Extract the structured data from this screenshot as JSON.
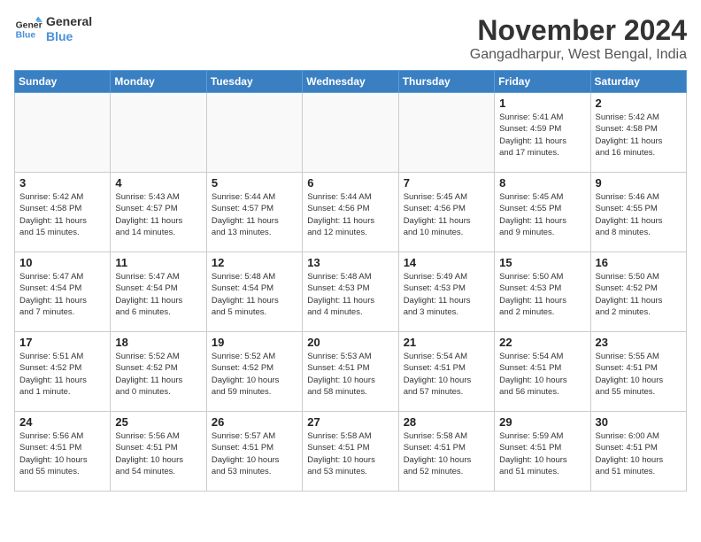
{
  "logo": {
    "line1": "General",
    "line2": "Blue"
  },
  "title": "November 2024",
  "location": "Gangadharpur, West Bengal, India",
  "headers": [
    "Sunday",
    "Monday",
    "Tuesday",
    "Wednesday",
    "Thursday",
    "Friday",
    "Saturday"
  ],
  "weeks": [
    [
      {
        "day": "",
        "info": "",
        "empty": true
      },
      {
        "day": "",
        "info": "",
        "empty": true
      },
      {
        "day": "",
        "info": "",
        "empty": true
      },
      {
        "day": "",
        "info": "",
        "empty": true
      },
      {
        "day": "",
        "info": "",
        "empty": true
      },
      {
        "day": "1",
        "info": "Sunrise: 5:41 AM\nSunset: 4:59 PM\nDaylight: 11 hours\nand 17 minutes."
      },
      {
        "day": "2",
        "info": "Sunrise: 5:42 AM\nSunset: 4:58 PM\nDaylight: 11 hours\nand 16 minutes."
      }
    ],
    [
      {
        "day": "3",
        "info": "Sunrise: 5:42 AM\nSunset: 4:58 PM\nDaylight: 11 hours\nand 15 minutes."
      },
      {
        "day": "4",
        "info": "Sunrise: 5:43 AM\nSunset: 4:57 PM\nDaylight: 11 hours\nand 14 minutes."
      },
      {
        "day": "5",
        "info": "Sunrise: 5:44 AM\nSunset: 4:57 PM\nDaylight: 11 hours\nand 13 minutes."
      },
      {
        "day": "6",
        "info": "Sunrise: 5:44 AM\nSunset: 4:56 PM\nDaylight: 11 hours\nand 12 minutes."
      },
      {
        "day": "7",
        "info": "Sunrise: 5:45 AM\nSunset: 4:56 PM\nDaylight: 11 hours\nand 10 minutes."
      },
      {
        "day": "8",
        "info": "Sunrise: 5:45 AM\nSunset: 4:55 PM\nDaylight: 11 hours\nand 9 minutes."
      },
      {
        "day": "9",
        "info": "Sunrise: 5:46 AM\nSunset: 4:55 PM\nDaylight: 11 hours\nand 8 minutes."
      }
    ],
    [
      {
        "day": "10",
        "info": "Sunrise: 5:47 AM\nSunset: 4:54 PM\nDaylight: 11 hours\nand 7 minutes."
      },
      {
        "day": "11",
        "info": "Sunrise: 5:47 AM\nSunset: 4:54 PM\nDaylight: 11 hours\nand 6 minutes."
      },
      {
        "day": "12",
        "info": "Sunrise: 5:48 AM\nSunset: 4:54 PM\nDaylight: 11 hours\nand 5 minutes."
      },
      {
        "day": "13",
        "info": "Sunrise: 5:48 AM\nSunset: 4:53 PM\nDaylight: 11 hours\nand 4 minutes."
      },
      {
        "day": "14",
        "info": "Sunrise: 5:49 AM\nSunset: 4:53 PM\nDaylight: 11 hours\nand 3 minutes."
      },
      {
        "day": "15",
        "info": "Sunrise: 5:50 AM\nSunset: 4:53 PM\nDaylight: 11 hours\nand 2 minutes."
      },
      {
        "day": "16",
        "info": "Sunrise: 5:50 AM\nSunset: 4:52 PM\nDaylight: 11 hours\nand 2 minutes."
      }
    ],
    [
      {
        "day": "17",
        "info": "Sunrise: 5:51 AM\nSunset: 4:52 PM\nDaylight: 11 hours\nand 1 minute."
      },
      {
        "day": "18",
        "info": "Sunrise: 5:52 AM\nSunset: 4:52 PM\nDaylight: 11 hours\nand 0 minutes."
      },
      {
        "day": "19",
        "info": "Sunrise: 5:52 AM\nSunset: 4:52 PM\nDaylight: 10 hours\nand 59 minutes."
      },
      {
        "day": "20",
        "info": "Sunrise: 5:53 AM\nSunset: 4:51 PM\nDaylight: 10 hours\nand 58 minutes."
      },
      {
        "day": "21",
        "info": "Sunrise: 5:54 AM\nSunset: 4:51 PM\nDaylight: 10 hours\nand 57 minutes."
      },
      {
        "day": "22",
        "info": "Sunrise: 5:54 AM\nSunset: 4:51 PM\nDaylight: 10 hours\nand 56 minutes."
      },
      {
        "day": "23",
        "info": "Sunrise: 5:55 AM\nSunset: 4:51 PM\nDaylight: 10 hours\nand 55 minutes."
      }
    ],
    [
      {
        "day": "24",
        "info": "Sunrise: 5:56 AM\nSunset: 4:51 PM\nDaylight: 10 hours\nand 55 minutes."
      },
      {
        "day": "25",
        "info": "Sunrise: 5:56 AM\nSunset: 4:51 PM\nDaylight: 10 hours\nand 54 minutes."
      },
      {
        "day": "26",
        "info": "Sunrise: 5:57 AM\nSunset: 4:51 PM\nDaylight: 10 hours\nand 53 minutes."
      },
      {
        "day": "27",
        "info": "Sunrise: 5:58 AM\nSunset: 4:51 PM\nDaylight: 10 hours\nand 53 minutes."
      },
      {
        "day": "28",
        "info": "Sunrise: 5:58 AM\nSunset: 4:51 PM\nDaylight: 10 hours\nand 52 minutes."
      },
      {
        "day": "29",
        "info": "Sunrise: 5:59 AM\nSunset: 4:51 PM\nDaylight: 10 hours\nand 51 minutes."
      },
      {
        "day": "30",
        "info": "Sunrise: 6:00 AM\nSunset: 4:51 PM\nDaylight: 10 hours\nand 51 minutes."
      }
    ]
  ]
}
